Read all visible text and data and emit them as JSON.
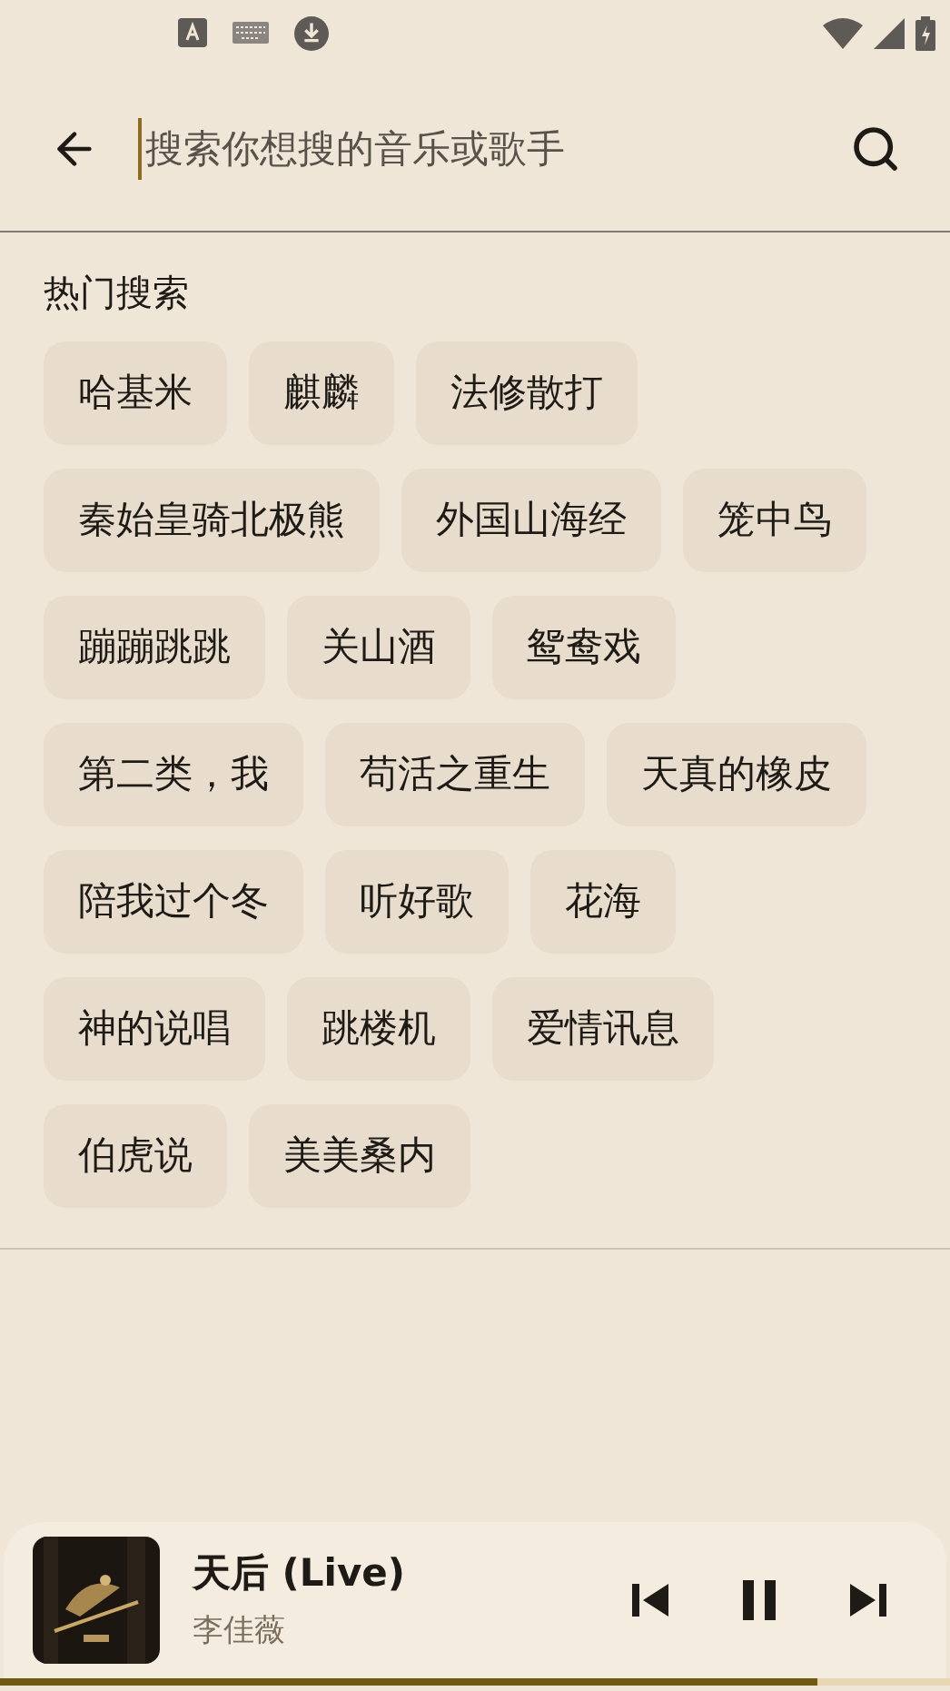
{
  "search": {
    "placeholder": "搜索你想搜的音乐或歌手"
  },
  "hot_search": {
    "title": "热门搜索",
    "tags": [
      "哈基米",
      "麒麟",
      "法修散打",
      "秦始皇骑北极熊",
      "外国山海经",
      "笼中鸟",
      "蹦蹦跳跳",
      "关山酒",
      "鸳鸯戏",
      "第二类，我",
      "苟活之重生",
      "天真的橡皮",
      "陪我过个冬",
      "听好歌",
      "花海",
      "神的说唱",
      "跳楼机",
      "爱情讯息",
      "伯虎说",
      "美美桑内"
    ]
  },
  "player": {
    "song": "天后 (Live)",
    "artist": "李佳薇",
    "playing": true,
    "level": 0.86
  }
}
